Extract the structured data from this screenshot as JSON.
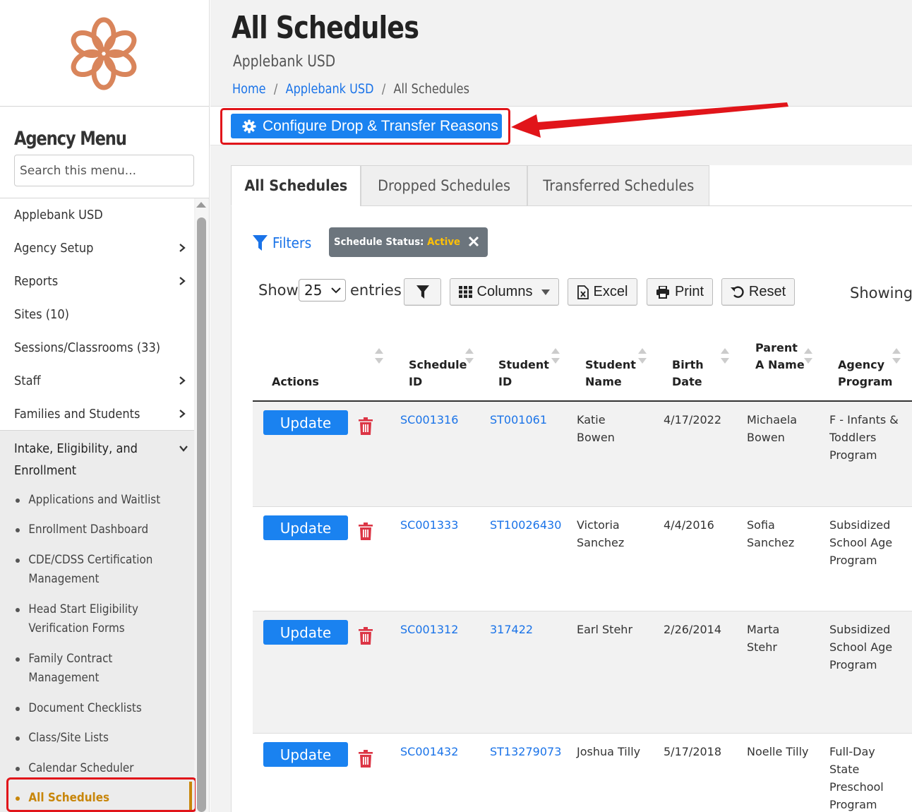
{
  "sidebar": {
    "menu_title": "Agency Menu",
    "search_placeholder": "Search this menu...",
    "items": [
      {
        "label": "Applebank USD",
        "has_children": false
      },
      {
        "label": "Agency Setup",
        "has_children": true
      },
      {
        "label": "Reports",
        "has_children": true
      },
      {
        "label": "Sites (10)",
        "has_children": false
      },
      {
        "label": "Sessions/Classrooms (33)",
        "has_children": false
      },
      {
        "label": "Staff",
        "has_children": true
      },
      {
        "label": "Families and Students",
        "has_children": true
      }
    ],
    "expanded_section": {
      "label": "Intake, Eligibility, and Enrollment",
      "sub_items": [
        {
          "label": "Applications and Waitlist"
        },
        {
          "label": "Enrollment Dashboard"
        },
        {
          "label": "CDE/CDSS Certification Management"
        },
        {
          "label": "Head Start Eligibility Verification Forms"
        },
        {
          "label": "Family Contract Management"
        },
        {
          "label": "Document Checklists"
        },
        {
          "label": "Class/Site Lists"
        },
        {
          "label": "Calendar Scheduler"
        },
        {
          "label": "All Schedules",
          "active": true
        }
      ]
    }
  },
  "header": {
    "title": "All Schedules",
    "subtitle": "Applebank USD",
    "breadcrumb": [
      "Home",
      "Applebank USD",
      "All Schedules"
    ]
  },
  "toolbar": {
    "config_button": "Configure Drop & Transfer Reasons"
  },
  "tabs": [
    {
      "label": "All Schedules",
      "active": true
    },
    {
      "label": "Dropped Schedules",
      "active": false
    },
    {
      "label": "Transferred Schedules",
      "active": false
    }
  ],
  "filters": {
    "label": "Filters",
    "chip_key": "Schedule Status:",
    "chip_value": "Active"
  },
  "datatable": {
    "show_label": "Show",
    "entries_value": "25",
    "entries_label": "entries",
    "columns_button": "Columns",
    "excel_button": "Excel",
    "print_button": "Print",
    "reset_button": "Reset",
    "showing_text": "Showing"
  },
  "table": {
    "headers": [
      "Actions",
      "Schedule ID",
      "Student ID",
      "Student Name",
      "Birth Date",
      "Parent A Name",
      "Agency Program"
    ],
    "update_label": "Update",
    "rows": [
      {
        "schedule_id": "SC001316",
        "student_id": "ST001061",
        "student_name": "Katie Bowen",
        "birth_date": "4/17/2022",
        "parent": "Michaela Bowen",
        "program": "F - Infants & Toddlers Program"
      },
      {
        "schedule_id": "SC001333",
        "student_id": "ST10026430",
        "student_name": "Victoria Sanchez",
        "birth_date": "4/4/2016",
        "parent": "Sofia Sanchez",
        "program": "Subsidized School Age Program"
      },
      {
        "schedule_id": "SC001312",
        "student_id": "317422",
        "student_name": "Earl Stehr",
        "birth_date": "2/26/2014",
        "parent": "Marta Stehr",
        "program": "Subsidized School Age Program"
      },
      {
        "schedule_id": "SC001432",
        "student_id": "ST13279073",
        "student_name": "Joshua Tilly",
        "birth_date": "5/17/2018",
        "parent": "Noelle Tilly",
        "program": "Full-Day State Preschool Program"
      }
    ]
  },
  "colors": {
    "primary": "#1a82f0",
    "link": "#1a73e8",
    "active_menu": "#c8860a",
    "annotation": "#e1151a",
    "logo": "#d9855b",
    "chip_value": "#ffc107",
    "trash": "#dc3545"
  }
}
